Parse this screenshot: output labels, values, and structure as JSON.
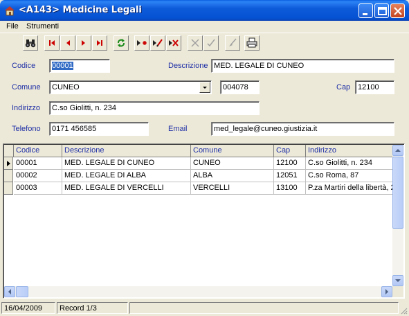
{
  "window": {
    "title": "<A143> Medicine Legali"
  },
  "menu": {
    "file": "File",
    "strumenti": "Strumenti"
  },
  "toolbar": {
    "buttons": [
      "binoculars-icon",
      "first-record-icon",
      "prev-record-icon",
      "next-record-icon",
      "last-record-icon",
      "refresh-icon",
      "new-record-icon",
      "edit-record-icon",
      "delete-record-icon",
      "cancel-icon",
      "confirm-icon",
      "clear-icon",
      "print-icon"
    ]
  },
  "form": {
    "codice_label": "Codice",
    "codice_value": "00001",
    "descrizione_label": "Descrizione",
    "descrizione_value": "MED. LEGALE DI CUNEO",
    "comune_label": "Comune",
    "comune_value": "CUNEO",
    "comune_code": "004078",
    "cap_label": "Cap",
    "cap_value": "12100",
    "indirizzo_label": "Indirizzo",
    "indirizzo_value": "C.so Giolitti, n. 234",
    "telefono_label": "Telefono",
    "telefono_value": "0171 456585",
    "email_label": "Email",
    "email_value": "med_legale@cuneo.giustizia.it"
  },
  "grid": {
    "columns": [
      "Codice",
      "Descrizione",
      "Comune",
      "Cap",
      "Indirizzo"
    ],
    "rows": [
      [
        "00001",
        "MED. LEGALE DI CUNEO",
        "CUNEO",
        "12100",
        "C.so Giolitti, n. 234"
      ],
      [
        "00002",
        "MED. LEGALE DI ALBA",
        "ALBA",
        "12051",
        "C.so Roma, 87"
      ],
      [
        "00003",
        "MED. LEGALE DI VERCELLI",
        "VERCELLI",
        "13100",
        "P.za Martiri della libertà, 2"
      ]
    ]
  },
  "status": {
    "date": "16/04/2009",
    "record": "Record 1/3"
  },
  "colors": {
    "label_blue": "#1F2FA6",
    "titlebar_blue": "#0553D4",
    "selection": "#316AC5"
  }
}
